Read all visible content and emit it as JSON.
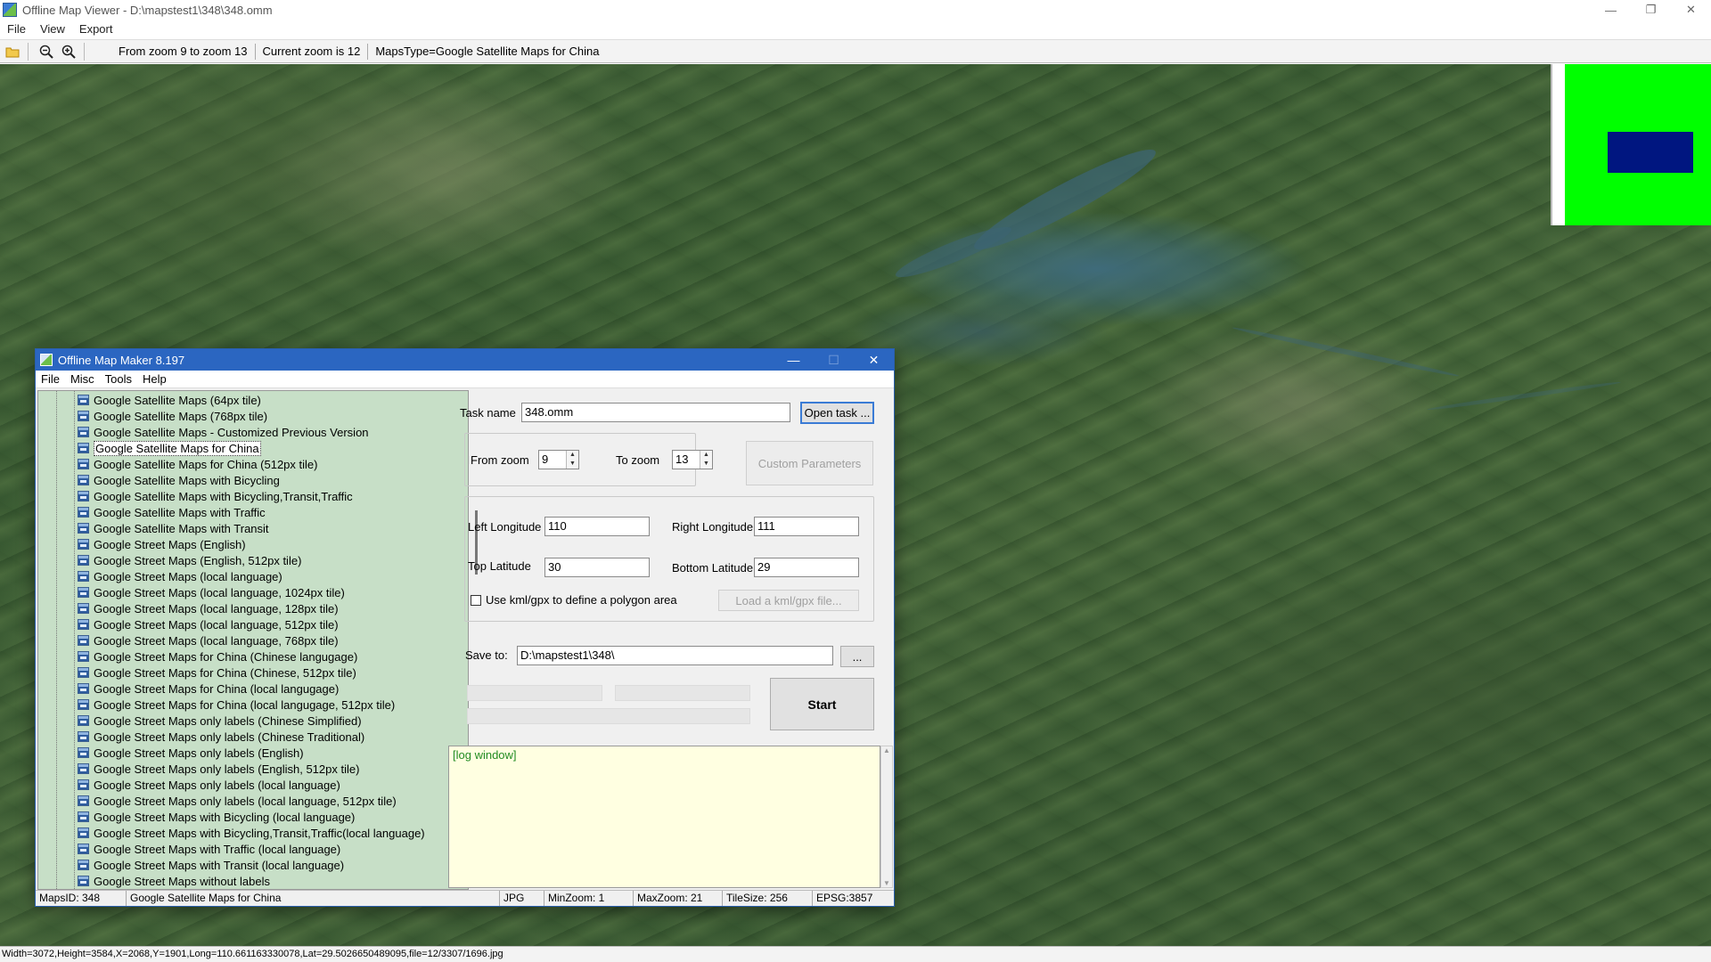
{
  "window": {
    "title": "Offline Map Viewer - D:\\mapstest1\\348\\348.omm",
    "controls": [
      "—",
      "❐",
      "✕"
    ]
  },
  "menu": [
    "File",
    "View",
    "Export"
  ],
  "toolbar": {
    "zoom_range": "From zoom 9 to zoom 13",
    "current_zoom": "Current zoom is 12",
    "maps_type": "MapsType=Google Satellite Maps for China"
  },
  "overview": {
    "colors": {
      "background": "#00ff00",
      "viewport": "#001680"
    }
  },
  "statusbar": {
    "text": "Width=3072,Height=3584,X=2068,Y=1901,Long=110.661163330078,Lat=29.5026650489095,file=12/3307/1696.jpg"
  },
  "dialog": {
    "title": "Offline Map Maker 8.197",
    "controls": [
      "—",
      "☐",
      "✕"
    ],
    "menu": [
      "File",
      "Misc",
      "Tools",
      "Help"
    ],
    "map_list": [
      "Google Satellite Maps (64px tile)",
      "Google Satellite Maps (768px tile)",
      "Google Satellite Maps - Customized Previous Version",
      "Google Satellite Maps for China",
      "Google Satellite Maps for China (512px tile)",
      "Google Satellite Maps with Bicycling",
      "Google Satellite Maps with Bicycling,Transit,Traffic",
      "Google Satellite Maps with Traffic",
      "Google Satellite Maps with Transit",
      "Google Street Maps (English)",
      "Google Street Maps (English, 512px tile)",
      "Google Street Maps (local language)",
      "Google Street Maps (local language, 1024px tile)",
      "Google Street Maps (local language, 128px tile)",
      "Google Street Maps (local language, 512px tile)",
      "Google Street Maps (local language, 768px tile)",
      "Google Street Maps for China (Chinese langugage)",
      "Google Street Maps for China (Chinese, 512px tile)",
      "Google Street Maps for China (local langugage)",
      "Google Street Maps for China (local langugage, 512px tile)",
      "Google Street Maps only labels (Chinese Simplified)",
      "Google Street Maps only labels (Chinese Traditional)",
      "Google Street Maps only labels (English)",
      "Google Street Maps only labels (English, 512px tile)",
      "Google Street Maps only labels (local language)",
      "Google Street Maps only labels (local language, 512px tile)",
      "Google Street Maps with Bicycling (local language)",
      "Google Street Maps with Bicycling,Transit,Traffic(local language)",
      "Google Street Maps with Traffic (local language)",
      "Google Street Maps with Transit (local language)",
      "Google Street Maps without labels"
    ],
    "selected_map": "Google Satellite Maps for China",
    "task_name_label": "Task name",
    "task_name_value": "348.omm",
    "open_task_label": "Open task ...",
    "from_zoom_label": "From zoom",
    "from_zoom_value": "9",
    "to_zoom_label": "To zoom",
    "to_zoom_value": "13",
    "custom_params_label": "Custom Parameters",
    "left_lon_label": "Left Longitude",
    "left_lon_value": "110",
    "right_lon_label": "Right Longitude",
    "right_lon_value": "111",
    "top_lat_label": "Top Latitude",
    "top_lat_value": "30",
    "bottom_lat_label": "Bottom Latitude",
    "bottom_lat_value": "29",
    "kml_checkbox_label": "Use kml/gpx to define a polygon area",
    "kml_checked": false,
    "load_kml_label": "Load a kml/gpx file...",
    "save_to_label": "Save to:",
    "save_to_value": "D:\\mapstest1\\348\\",
    "browse_label": "...",
    "start_label": "Start",
    "log_text": "[log window]",
    "status": {
      "maps_id": "MapsID: 348",
      "map_name": "Google Satellite Maps for China",
      "format": "JPG",
      "min_zoom": "MinZoom: 1",
      "max_zoom": "MaxZoom: 21",
      "tile_size": "TileSize: 256",
      "epsg": "EPSG:3857"
    }
  }
}
